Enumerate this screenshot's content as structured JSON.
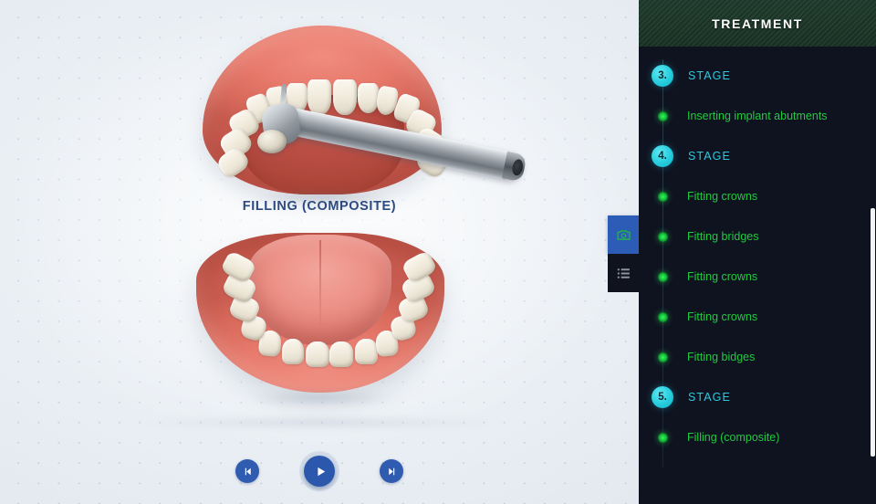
{
  "viewport": {
    "caption": "FILLING (COMPOSITE)",
    "models": {
      "upper_jaw": "upper-jaw-model",
      "lower_jaw": "lower-jaw-model",
      "instrument": "dental-drill-handpiece"
    }
  },
  "tools": [
    {
      "name": "screenshot-tool",
      "icon": "camera-icon",
      "active": true,
      "accent": "#2c5cb5",
      "icon_color": "#22b24a"
    },
    {
      "name": "list-tool",
      "icon": "list-icon",
      "active": false,
      "accent": "#10131d",
      "icon_color": "#8e93a0"
    }
  ],
  "playback": {
    "previous_label": "skip-back-icon",
    "play_label": "play-icon",
    "next_label": "skip-forward-icon"
  },
  "sidebar": {
    "title": "TREATMENT",
    "colors": {
      "header_bg": "#1e3b2c",
      "panel_bg": "#0f1320",
      "stage_accent": "#2fc8dc",
      "task_accent": "#22c940"
    },
    "items": [
      {
        "type": "stage",
        "number": "3.",
        "label": "STAGE"
      },
      {
        "type": "task",
        "label": "Inserting implant abutments"
      },
      {
        "type": "stage",
        "number": "4.",
        "label": "STAGE"
      },
      {
        "type": "task",
        "label": "Fitting crowns"
      },
      {
        "type": "task",
        "label": "Fitting bridges"
      },
      {
        "type": "task",
        "label": "Fitting crowns"
      },
      {
        "type": "task",
        "label": "Fitting crowns"
      },
      {
        "type": "task",
        "label": "Fitting bidges"
      },
      {
        "type": "stage",
        "number": "5.",
        "label": "STAGE"
      },
      {
        "type": "task",
        "label": "Filling (composite)"
      }
    ]
  }
}
